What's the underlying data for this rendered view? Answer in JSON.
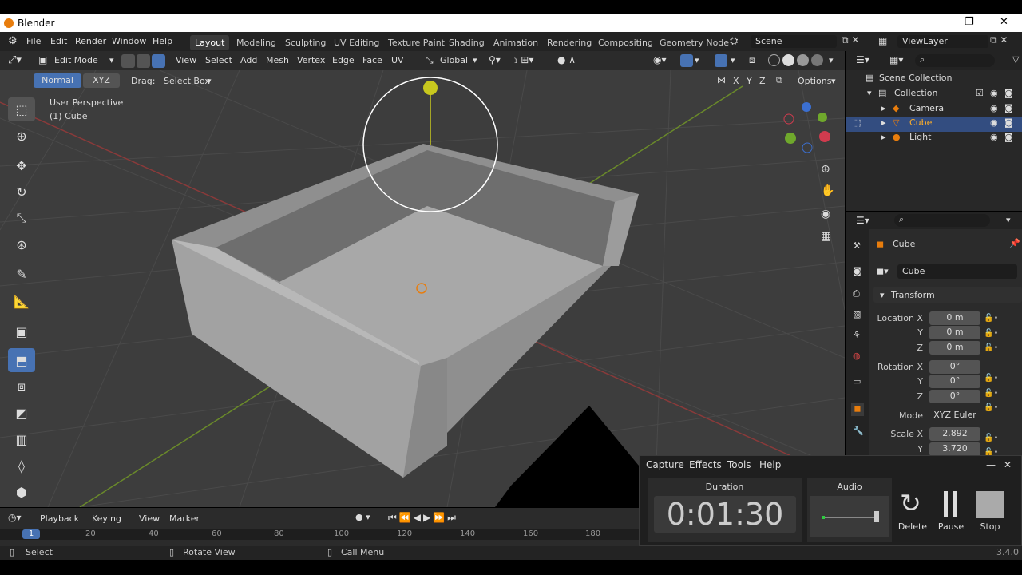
{
  "window": {
    "title": "Blender",
    "minimize": "—",
    "maximize": "❐",
    "close": "✕"
  },
  "menu": [
    "File",
    "Edit",
    "Render",
    "Window",
    "Help"
  ],
  "workspaces": [
    "Layout",
    "Modeling",
    "Sculpting",
    "UV Editing",
    "Texture Paint",
    "Shading",
    "Animation",
    "Rendering",
    "Compositing",
    "Geometry Node"
  ],
  "scene": {
    "label": "Scene",
    "view_layer": "ViewLayer"
  },
  "viewport_header": {
    "mode": "Edit Mode",
    "menus": [
      "View",
      "Select",
      "Add",
      "Mesh",
      "Vertex",
      "Edge",
      "Face",
      "UV"
    ],
    "orientation": "Global",
    "options": "Options"
  },
  "tool_header": {
    "normal": "Normal",
    "xyz": "XYZ",
    "drag_label": "Drag:",
    "drag_value": "Select Box"
  },
  "viewport": {
    "perspective": "User Perspective",
    "object": "(1) Cube",
    "axes": [
      "X",
      "Y",
      "Z"
    ]
  },
  "outliner": {
    "root": "Scene Collection",
    "collection": "Collection",
    "items": [
      {
        "name": "Camera",
        "selected": false,
        "icon": "camera-icon"
      },
      {
        "name": "Cube",
        "selected": true,
        "icon": "mesh-icon"
      },
      {
        "name": "Light",
        "selected": false,
        "icon": "light-icon"
      }
    ]
  },
  "properties": {
    "object_name": "Cube",
    "data_name": "Cube",
    "panel": "Transform",
    "location": {
      "label": "Location X",
      "x": "0 m",
      "y": "0 m",
      "z": "0 m"
    },
    "rotation": {
      "label": "Rotation X",
      "x": "0°",
      "y": "0°",
      "z": "0°"
    },
    "mode_label": "Mode",
    "mode_value": "XYZ Euler",
    "scale": {
      "label": "Scale X",
      "x": "2.892",
      "y": "3.720"
    },
    "axis_y": "Y",
    "axis_z": "Z"
  },
  "timeline": {
    "menus": [
      "Playback",
      "Keying",
      "View",
      "Marker"
    ],
    "current_frame": "1",
    "ticks": [
      "20",
      "40",
      "60",
      "80",
      "100",
      "120",
      "140",
      "160",
      "180"
    ]
  },
  "statusbar": {
    "select": "Select",
    "rotate": "Rotate View",
    "menu": "Call Menu",
    "version": "3.4.0"
  },
  "capture": {
    "menus": [
      "Capture",
      "Effects",
      "Tools",
      "Help"
    ],
    "duration_label": "Duration",
    "duration": "0:01:30",
    "audio_label": "Audio",
    "delete": "Delete",
    "pause": "Pause",
    "stop": "Stop"
  },
  "colors": {
    "accent": "#4772b3",
    "selected_row": "#334d80",
    "viewport": "#3d3d3d",
    "orange": "#e87d0d"
  }
}
